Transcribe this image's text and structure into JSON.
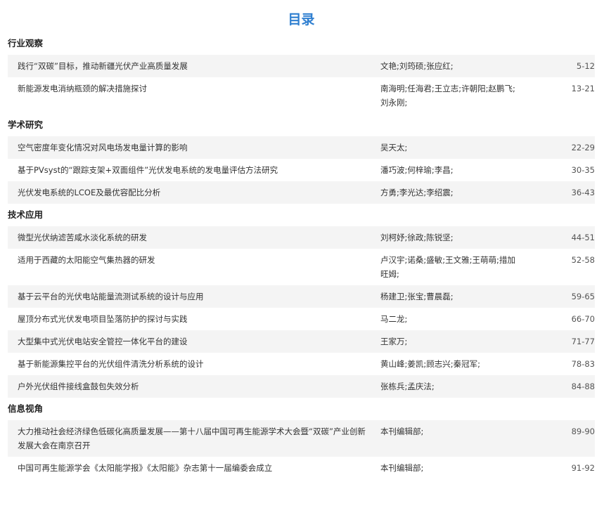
{
  "title": "目录",
  "sections": [
    {
      "heading": "行业观察",
      "items": [
        {
          "title": "践行“双碳”目标，推动新疆光伏产业高质量发展",
          "authors": "文艳;刘筠硕;张应红;",
          "pages": "5-12"
        },
        {
          "title": "新能源发电消纳瓶颈的解决措施探讨",
          "authors": "南海明;任海君;王立志;许朝阳;赵鹏飞;刘永刚;",
          "pages": "13-21"
        }
      ]
    },
    {
      "heading": "学术研究",
      "items": [
        {
          "title": "空气密度年变化情况对风电场发电量计算的影响",
          "authors": "吴天太;",
          "pages": "22-29"
        },
        {
          "title": "基于PVsyst的“跟踪支架+双面组件”光伏发电系统的发电量评估方法研究",
          "authors": "潘巧波;何梓瑜;李昌;",
          "pages": "30-35"
        },
        {
          "title": "光伏发电系统的LCOE及最优容配比分析",
          "authors": "方勇;李光达;李绍震;",
          "pages": "36-43"
        }
      ]
    },
    {
      "heading": "技术应用",
      "items": [
        {
          "title": "微型光伏纳滤苦咸水淡化系统的研发",
          "authors": "刘柯妤;徐政;陈锐坚;",
          "pages": "44-51"
        },
        {
          "title": "适用于西藏的太阳能空气集热器的研发",
          "authors": "卢汉宇;诺桑;盛敏;王文雅;王萌萌;措加旺姆;",
          "pages": "52-58"
        },
        {
          "title": "基于云平台的光伏电站能量流测试系统的设计与应用",
          "authors": "杨建卫;张宝;曹晨磊;",
          "pages": "59-65"
        },
        {
          "title": "屋顶分布式光伏发电项目坠落防护的探讨与实践",
          "authors": "马二龙;",
          "pages": "66-70"
        },
        {
          "title": "大型集中式光伏电站安全管控一体化平台的建设",
          "authors": "王家万;",
          "pages": "71-77"
        },
        {
          "title": "基于新能源集控平台的光伏组件清洗分析系统的设计",
          "authors": "黄山峰;姜凯;顾志兴;秦冠军;",
          "pages": "78-83"
        },
        {
          "title": "户外光伏组件接线盒鼓包失效分析",
          "authors": "张栋兵;孟庆法;",
          "pages": "84-88"
        }
      ]
    },
    {
      "heading": "信息视角",
      "items": [
        {
          "title": "大力推动社会经济绿色低碳化高质量发展——第十八届中国可再生能源学术大会暨“双碳”产业创新发展大会在南京召开",
          "authors": "本刊编辑部;",
          "pages": "89-90"
        },
        {
          "title": "中国可再生能源学会《太阳能学报》《太阳能》杂志第十一届编委会成立",
          "authors": "本刊编辑部;",
          "pages": "91-92"
        }
      ]
    }
  ]
}
